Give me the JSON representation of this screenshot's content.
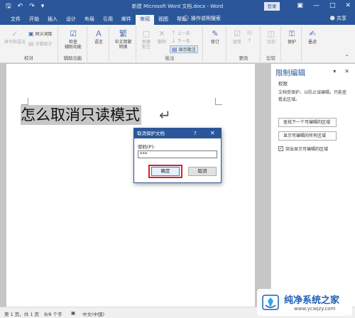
{
  "titlebar": {
    "title": "新建 Microsoft Word 文档.docx - Word",
    "login_label": "登录",
    "qat_icons": [
      "save-icon",
      "undo-icon",
      "redo-icon",
      "customize-icon"
    ]
  },
  "tabs": [
    {
      "label": "文件",
      "active": false
    },
    {
      "label": "开始",
      "active": false
    },
    {
      "label": "插入",
      "active": false
    },
    {
      "label": "设计",
      "active": false
    },
    {
      "label": "布局",
      "active": false
    },
    {
      "label": "引用",
      "active": false
    },
    {
      "label": "邮件",
      "active": false
    },
    {
      "label": "审阅",
      "active": true
    },
    {
      "label": "视图",
      "active": false
    },
    {
      "label": "帮助",
      "active": false
    }
  ],
  "tellme": "操作说明搜索",
  "share": "共享",
  "ribbon": {
    "groups": {
      "proofing": "校对",
      "accessibility": "辅助功能",
      "comments": "批注",
      "changes": "更改",
      "compare": "比较"
    },
    "spelling": "拼写和语法",
    "thesaurus": "同义词库",
    "wordcount": "字数统计",
    "check_access": [
      "检查",
      "辅助功能"
    ],
    "language": "语言",
    "chinese_convert": [
      "中文简繁",
      "转换"
    ],
    "new_comment": [
      "新建",
      "批注"
    ],
    "delete": "删除",
    "prev": "上一条",
    "next": "下一条",
    "show_comments": "显示批注",
    "track": "修订",
    "accept": "接受",
    "compare_btn": "比较",
    "protect": "保护",
    "ink": "墨迹"
  },
  "document": {
    "text": "怎么取消只读模式",
    "para_mark": "↵"
  },
  "pane": {
    "title": "限制编辑",
    "subtitle": "权限",
    "desc": "文档受保护，以防止误编辑。只能查看此区域。",
    "btn_find": "查找下一个可编辑的区域",
    "btn_show": "显示可编辑的所有区域",
    "check_label": "突出显示可编辑的区域",
    "checked": true
  },
  "dialog": {
    "title": "取消保护文档",
    "help": "?",
    "password_label": "密码(P):",
    "password_value": "***",
    "ok": "确定",
    "cancel": "取消"
  },
  "status": {
    "page": "第 1 页，共 1 页",
    "words": "8/8 个字",
    "lang": "中文(中国)"
  },
  "watermark": {
    "name": "纯净系统之家",
    "url": "www.ycwjzy.com"
  }
}
